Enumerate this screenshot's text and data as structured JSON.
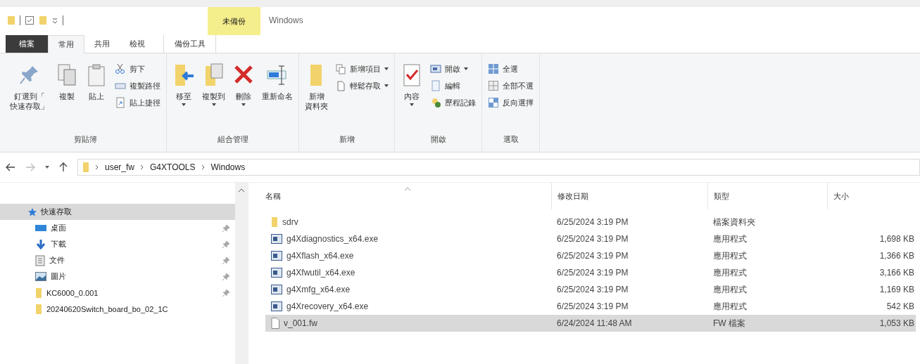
{
  "window": {
    "title": "Windows"
  },
  "context_header": "未備份",
  "tabs": [
    {
      "label": "檔案",
      "kind": "file",
      "selected": false
    },
    {
      "label": "常用",
      "kind": "normal",
      "selected": true
    },
    {
      "label": "共用",
      "kind": "normal",
      "selected": false
    },
    {
      "label": "檢視",
      "kind": "normal",
      "selected": false
    },
    {
      "label": "備份工具",
      "kind": "contextual",
      "selected": false
    }
  ],
  "ribbon": [
    {
      "label": "剪貼簿",
      "buttons": [
        {
          "lines": [
            "釘選到「",
            "快速存取」"
          ],
          "kind": "large",
          "dropdown": false
        },
        {
          "lines": [
            "複製"
          ],
          "kind": "large",
          "dropdown": false
        },
        {
          "lines": [
            "貼上"
          ],
          "kind": "large",
          "dropdown": false
        },
        {
          "label": "剪下",
          "kind": "small",
          "dropdown": false
        },
        {
          "label": "複製路徑",
          "kind": "small",
          "dropdown": false
        },
        {
          "label": "貼上捷徑",
          "kind": "small",
          "dropdown": false
        }
      ]
    },
    {
      "label": "組合管理",
      "buttons": [
        {
          "lines": [
            "移至"
          ],
          "kind": "large",
          "dropdown": true
        },
        {
          "lines": [
            "複製到"
          ],
          "kind": "large",
          "dropdown": true
        },
        {
          "lines": [
            "刪除"
          ],
          "kind": "large",
          "dropdown": true
        },
        {
          "lines": [
            "重新命名"
          ],
          "kind": "large",
          "dropdown": false
        }
      ]
    },
    {
      "label": "新增",
      "buttons": [
        {
          "lines": [
            "新增",
            "資料夾"
          ],
          "kind": "large",
          "dropdown": false
        },
        {
          "label": "新增項目",
          "kind": "small",
          "dropdown": true
        },
        {
          "label": "輕鬆存取",
          "kind": "small",
          "dropdown": true
        }
      ]
    },
    {
      "label": "開啟",
      "buttons": [
        {
          "lines": [
            "內容"
          ],
          "kind": "large",
          "dropdown": true
        },
        {
          "label": "開啟",
          "kind": "small",
          "dropdown": true
        },
        {
          "label": "編輯",
          "kind": "small",
          "dropdown": false
        },
        {
          "label": "歷程記錄",
          "kind": "small",
          "dropdown": false
        }
      ]
    },
    {
      "label": "選取",
      "buttons": [
        {
          "label": "全選",
          "kind": "small",
          "dropdown": false
        },
        {
          "label": "全部不選",
          "kind": "small",
          "dropdown": false
        },
        {
          "label": "反向選擇",
          "kind": "small",
          "dropdown": false
        }
      ]
    }
  ],
  "address": [
    "user_fw",
    "G4XTOOLS",
    "Windows"
  ],
  "sidebar": [
    {
      "label": "快速存取",
      "selected": true,
      "pinned": false,
      "children": [
        {
          "label": "桌面",
          "selected": false,
          "pinned": true
        },
        {
          "label": "下載",
          "selected": false,
          "pinned": true
        },
        {
          "label": "文件",
          "selected": false,
          "pinned": true
        },
        {
          "label": "圖片",
          "selected": false,
          "pinned": true
        },
        {
          "label": "KC6000_0.001",
          "selected": false,
          "pinned": true
        },
        {
          "label": "20240620Switch_board_bo_02_1C",
          "selected": false,
          "pinned": false
        }
      ]
    }
  ],
  "columns": [
    "名稱",
    "修改日期",
    "類型",
    "大小"
  ],
  "rows": [
    {
      "kind": "folder",
      "name": "sdrv",
      "modified": "6/25/2024 3:19 PM",
      "type": "檔案資料夾",
      "size": "",
      "selected": false
    },
    {
      "kind": "exe",
      "name": "g4Xdiagnostics_x64.exe",
      "modified": "6/25/2024 3:19 PM",
      "type": "應用程式",
      "size": "1,698 KB",
      "selected": false
    },
    {
      "kind": "exe",
      "name": "g4Xflash_x64.exe",
      "modified": "6/25/2024 3:19 PM",
      "type": "應用程式",
      "size": "1,366 KB",
      "selected": false
    },
    {
      "kind": "exe",
      "name": "g4Xfwutil_x64.exe",
      "modified": "6/25/2024 3:19 PM",
      "type": "應用程式",
      "size": "3,166 KB",
      "selected": false
    },
    {
      "kind": "exe",
      "name": "g4Xmfg_x64.exe",
      "modified": "6/25/2024 3:19 PM",
      "type": "應用程式",
      "size": "1,169 KB",
      "selected": false
    },
    {
      "kind": "exe",
      "name": "g4Xrecovery_x64.exe",
      "modified": "6/25/2024 3:19 PM",
      "type": "應用程式",
      "size": "542 KB",
      "selected": false
    },
    {
      "kind": "file",
      "name": "v_001.fw",
      "modified": "6/24/2024 11:48 AM",
      "type": "FW 檔案",
      "size": "1,053 KB",
      "selected": true
    }
  ]
}
